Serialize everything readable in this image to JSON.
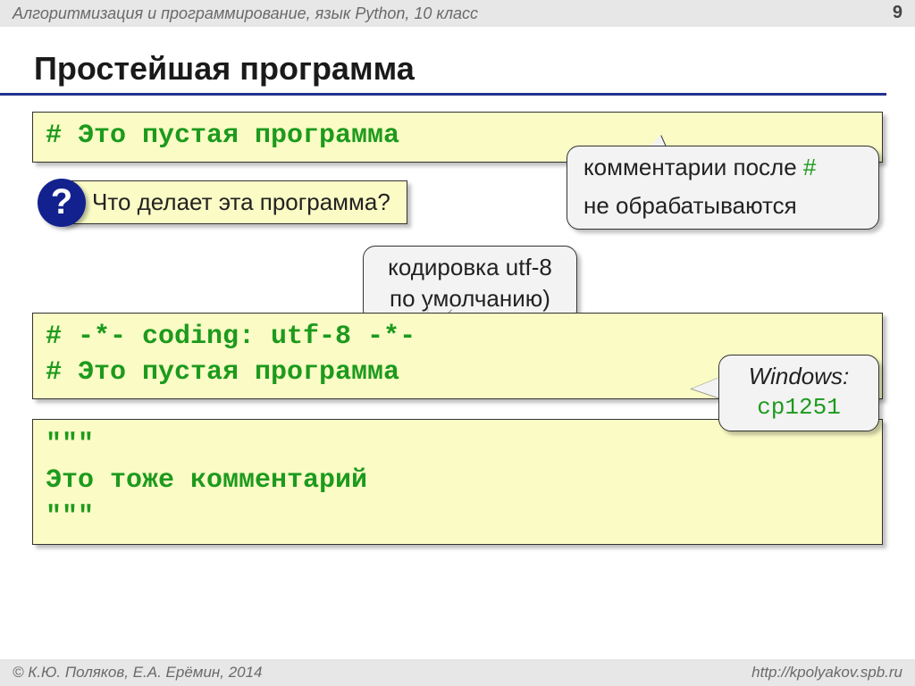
{
  "header": {
    "subject": "Алгоритмизация и программирование, язык Python, 10 класс",
    "page": "9"
  },
  "title": "Простейшая программа",
  "code1": "# Это пустая программа",
  "question": {
    "icon": "?",
    "text": "Что делает эта программа?"
  },
  "callout1": {
    "line1a": "комментарии после ",
    "line1b": "#",
    "line2": "не обрабатываются"
  },
  "callout2": {
    "line1": "кодировка utf-8",
    "line2": "по умолчанию)"
  },
  "code2": {
    "line1": "# -*- coding: utf-8 -*-",
    "line2": "# Это пустая программа"
  },
  "callout3": {
    "line1": "Windows:",
    "line2": "cp1251"
  },
  "code3": {
    "line1": "\"\"\"",
    "line2": "Это тоже комментарий",
    "line3": "\"\"\""
  },
  "footer": {
    "left": "© К.Ю. Поляков, Е.А. Ерёмин, 2014",
    "right": "http://kpolyakov.spb.ru"
  }
}
